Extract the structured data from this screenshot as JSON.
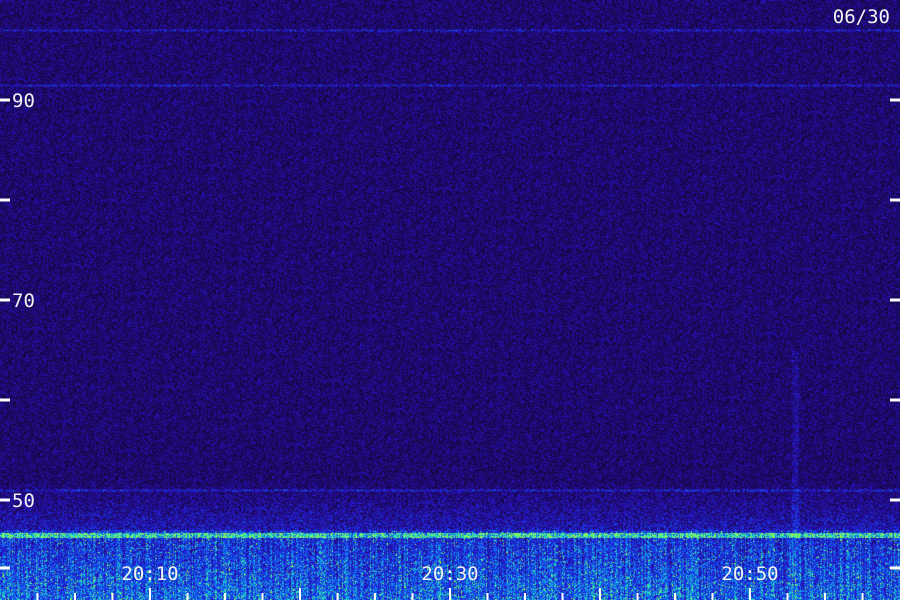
{
  "chart_data": {
    "type": "heatmap",
    "date_label": "06/30",
    "y_axis": {
      "range": [
        40,
        100
      ],
      "labeled_ticks": [
        {
          "value": 90,
          "label": "90"
        },
        {
          "value": 70,
          "label": "70"
        },
        {
          "value": 50,
          "label": "50"
        }
      ],
      "minor_ticks": [
        80,
        60,
        40
      ]
    },
    "x_axis": {
      "range_minutes": [
        0,
        60
      ],
      "labeled_ticks": [
        {
          "minute": 10,
          "label": "20:10"
        },
        {
          "minute": 30,
          "label": "20:30"
        },
        {
          "minute": 50,
          "label": "20:50"
        }
      ],
      "minor_tick_step_minutes": 2.5
    },
    "features": {
      "noise_floor_above": 52,
      "strong_band_below": 47,
      "horizontal_lines_at": [
        97,
        91.5,
        51,
        46.5
      ],
      "vertical_streak_at_minute": 53
    },
    "colors": {
      "background_low": "#1a0850",
      "background_mid": "#2a10c8",
      "band_mid": "#0a60ff",
      "band_high": "#20e8c0",
      "peak": "#a0ff40",
      "axis": "#ffffff"
    }
  }
}
